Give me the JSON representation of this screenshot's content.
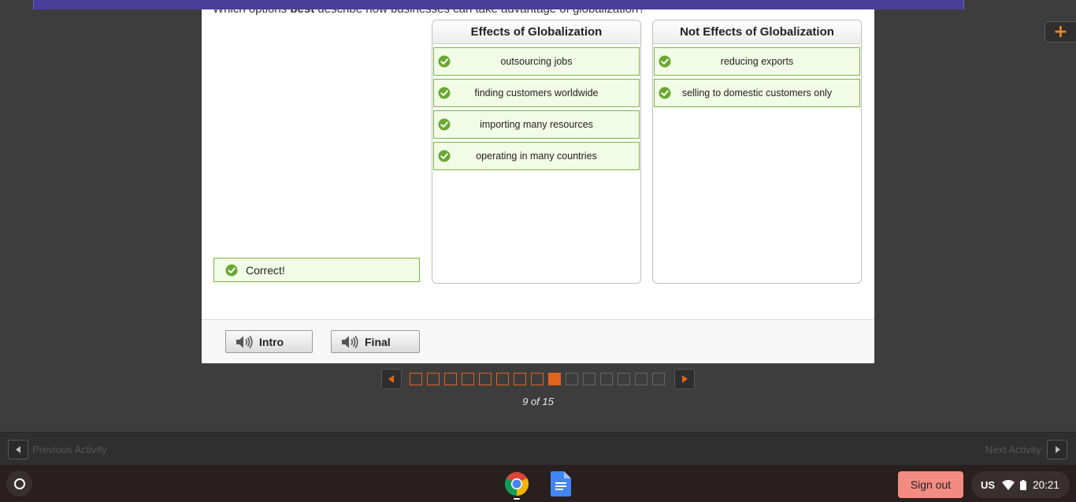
{
  "question": {
    "prefix": "Which options",
    "emphasis": "best",
    "suffix": "describe how businesses can take advantage of globalization?"
  },
  "columns": [
    {
      "title": "Effects of Globalization",
      "items": [
        "outsourcing jobs",
        "finding customers worldwide",
        "importing many resources",
        "operating in many countries"
      ]
    },
    {
      "title": "Not Effects of Globalization",
      "items": [
        "reducing exports",
        "selling to domestic customers only"
      ]
    }
  ],
  "feedback": {
    "text": "Correct!"
  },
  "audio_buttons": {
    "intro": "Intro",
    "final": "Final"
  },
  "pager": {
    "current": 9,
    "total": 15,
    "label": "9 of 15"
  },
  "activity_nav": {
    "previous": "Previous Activity",
    "next": "Next Activity"
  },
  "shelf": {
    "apps": [
      "chrome-icon",
      "google-docs-icon"
    ],
    "sign_out": "Sign out",
    "keyboard_layout": "US",
    "time": "20:21"
  },
  "colors": {
    "accent": "#e0641c",
    "correct_border": "#7cb342",
    "correct_fill": "#f2fbe6",
    "check": "#6aa832",
    "plus": "#f08a24",
    "sign_out": "#f28b82"
  }
}
